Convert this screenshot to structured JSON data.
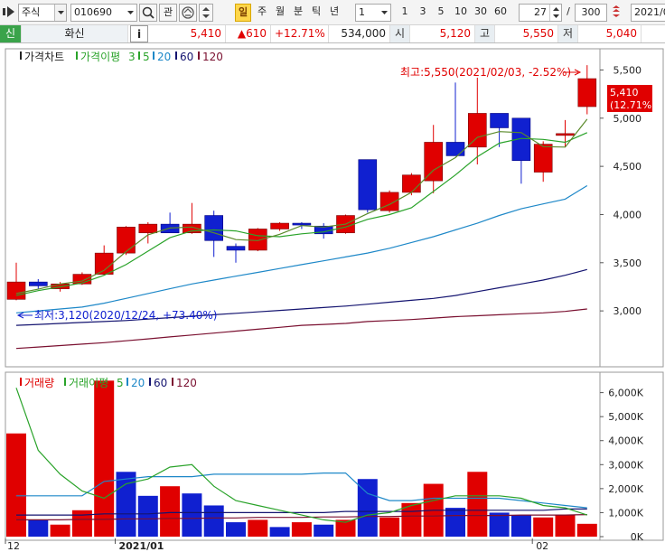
{
  "toolbar": {
    "market_select": "주식",
    "code_input": "010690",
    "watch_label": "관",
    "period_badge": "일",
    "period_tabs": [
      "주",
      "월",
      "분",
      "틱",
      "년"
    ],
    "unit_select": "1",
    "interval_buttons": [
      "1",
      "3",
      "5",
      "10",
      "30",
      "60"
    ],
    "count_value": "27",
    "slash": "/",
    "total_value": "300",
    "date_value": "2021/0"
  },
  "quote": {
    "credit_badge": "신",
    "name": "화신",
    "info_button": "i",
    "price": "5,410",
    "change": "▲610",
    "change_rate": "+12.71%",
    "volume": "534,000",
    "open_label": "시",
    "open": "5,120",
    "high_label": "고",
    "high": "5,550",
    "low_label": "저",
    "low": "5,040"
  },
  "colors": {
    "up": "#e00000",
    "down": "#1020d0",
    "ma5": "#2aa32a",
    "ma20": "#1e88c8",
    "ma60": "#141470",
    "ma120": "#7a1030"
  },
  "chart_data": [
    {
      "type": "candlestick",
      "legend": {
        "title": "가격차트",
        "ma_label": "가격이평",
        "items": [
          "3",
          "5",
          "20",
          "60",
          "120"
        ]
      },
      "x_labels": [
        {
          "label": "12",
          "index": 0
        },
        {
          "label": "2021/01",
          "index": 5
        },
        {
          "label": "02",
          "index": 24
        }
      ],
      "ylim": [
        2420,
        5720
      ],
      "yticks": [
        3000,
        3500,
        4000,
        4500,
        5000,
        5500
      ],
      "ytick_labels": [
        "3,000",
        "3,500",
        "4,000",
        "4,500",
        "5,000",
        "5,500"
      ],
      "candles": [
        {
          "o": 3120,
          "h": 3500,
          "l": 3110,
          "c": 3300
        },
        {
          "o": 3300,
          "h": 3330,
          "l": 3230,
          "c": 3260
        },
        {
          "o": 3230,
          "h": 3300,
          "l": 3200,
          "c": 3280
        },
        {
          "o": 3280,
          "h": 3400,
          "l": 3270,
          "c": 3380
        },
        {
          "o": 3380,
          "h": 3680,
          "l": 3370,
          "c": 3600
        },
        {
          "o": 3600,
          "h": 3880,
          "l": 3580,
          "c": 3870
        },
        {
          "o": 3810,
          "h": 3920,
          "l": 3700,
          "c": 3900
        },
        {
          "o": 3900,
          "h": 4020,
          "l": 3830,
          "c": 3810
        },
        {
          "o": 3810,
          "h": 4120,
          "l": 3800,
          "c": 3900
        },
        {
          "o": 3990,
          "h": 4040,
          "l": 3560,
          "c": 3730
        },
        {
          "o": 3670,
          "h": 3700,
          "l": 3500,
          "c": 3630
        },
        {
          "o": 3630,
          "h": 3860,
          "l": 3620,
          "c": 3850
        },
        {
          "o": 3850,
          "h": 3920,
          "l": 3830,
          "c": 3910
        },
        {
          "o": 3910,
          "h": 3920,
          "l": 3850,
          "c": 3900
        },
        {
          "o": 3880,
          "h": 3910,
          "l": 3750,
          "c": 3800
        },
        {
          "o": 3810,
          "h": 4000,
          "l": 3800,
          "c": 3990
        },
        {
          "o": 4570,
          "h": 4570,
          "l": 4020,
          "c": 4050
        },
        {
          "o": 4040,
          "h": 4250,
          "l": 4020,
          "c": 4230
        },
        {
          "o": 4230,
          "h": 4430,
          "l": 4200,
          "c": 4410
        },
        {
          "o": 4350,
          "h": 4930,
          "l": 4220,
          "c": 4750
        },
        {
          "o": 4750,
          "h": 5370,
          "l": 4630,
          "c": 4610
        },
        {
          "o": 4700,
          "h": 5420,
          "l": 4520,
          "c": 5050
        },
        {
          "o": 5050,
          "h": 5020,
          "l": 4700,
          "c": 4900
        },
        {
          "o": 5000,
          "h": 5000,
          "l": 4320,
          "c": 4560
        },
        {
          "o": 4440,
          "h": 4760,
          "l": 4340,
          "c": 4730
        },
        {
          "o": 4840,
          "h": 4980,
          "l": 4700,
          "c": 4840
        },
        {
          "o": 5120,
          "h": 5550,
          "l": 5040,
          "c": 5410
        }
      ],
      "ma3": [
        3180,
        3225,
        3280,
        3310,
        3420,
        3615,
        3790,
        3860,
        3870,
        3810,
        3740,
        3730,
        3795,
        3885,
        3870,
        3900,
        4010,
        4105,
        4230,
        4460,
        4590,
        4800,
        4860,
        4850,
        4705,
        4700,
        4990
      ],
      "ma5": [
        3160,
        3210,
        3250,
        3290,
        3370,
        3480,
        3620,
        3760,
        3830,
        3840,
        3830,
        3780,
        3770,
        3800,
        3820,
        3870,
        3950,
        4000,
        4070,
        4240,
        4410,
        4600,
        4740,
        4790,
        4780,
        4750,
        4850
      ],
      "ma20": [
        2980,
        3000,
        3020,
        3040,
        3080,
        3130,
        3180,
        3230,
        3280,
        3320,
        3360,
        3400,
        3440,
        3480,
        3520,
        3560,
        3600,
        3650,
        3710,
        3770,
        3840,
        3910,
        3990,
        4060,
        4110,
        4160,
        4300
      ],
      "ma60": [
        2850,
        2860,
        2870,
        2880,
        2890,
        2900,
        2915,
        2930,
        2945,
        2960,
        2975,
        2990,
        3005,
        3020,
        3035,
        3050,
        3070,
        3090,
        3110,
        3130,
        3160,
        3200,
        3240,
        3280,
        3320,
        3370,
        3430
      ],
      "ma120": [
        2610,
        2625,
        2640,
        2655,
        2670,
        2690,
        2710,
        2730,
        2750,
        2770,
        2790,
        2810,
        2830,
        2850,
        2860,
        2870,
        2890,
        2900,
        2910,
        2925,
        2940,
        2950,
        2960,
        2970,
        2980,
        2995,
        3020
      ],
      "annotations": {
        "high": "최고:5,550(2021/02/03, -2.52%)",
        "low": "최저:3,120(2020/12/24, +73.40%)",
        "current_price": "5,410",
        "current_rate": "(12.71%)"
      }
    },
    {
      "type": "bar",
      "legend": {
        "title": "거래량",
        "ma_label": "거래이평",
        "items": [
          "5",
          "20",
          "60",
          "120"
        ]
      },
      "ylim": [
        0,
        6700
      ],
      "yticks": [
        0,
        1000,
        2000,
        3000,
        4000,
        5000,
        6000
      ],
      "ytick_labels": [
        "0K",
        "1,000K",
        "2,000K",
        "3,000K",
        "4,000K",
        "5,000K",
        "6,000K"
      ],
      "volumes": [
        4300,
        700,
        500,
        1100,
        6500,
        2700,
        1700,
        2100,
        1800,
        1300,
        600,
        700,
        400,
        600,
        500,
        700,
        2400,
        800,
        1400,
        2200,
        1200,
        2700,
        1000,
        900,
        800,
        900,
        534
      ],
      "up": [
        true,
        false,
        true,
        true,
        true,
        false,
        false,
        true,
        false,
        false,
        false,
        true,
        false,
        true,
        false,
        true,
        false,
        true,
        true,
        true,
        false,
        true,
        false,
        false,
        true,
        true,
        true
      ],
      "vma5": [
        6200,
        3600,
        2600,
        1900,
        1600,
        2200,
        2400,
        2900,
        3000,
        2100,
        1500,
        1300,
        1100,
        900,
        700,
        600,
        900,
        1000,
        1300,
        1500,
        1700,
        1700,
        1700,
        1600,
        1300,
        1200,
        900
      ],
      "vma20": [
        1700,
        1700,
        1700,
        1700,
        2300,
        2400,
        2500,
        2500,
        2500,
        2600,
        2600,
        2600,
        2600,
        2600,
        2650,
        2650,
        1800,
        1500,
        1500,
        1600,
        1600,
        1600,
        1600,
        1500,
        1400,
        1300,
        1200
      ],
      "vma60": [
        900,
        900,
        900,
        900,
        950,
        950,
        950,
        1000,
        1000,
        1000,
        1000,
        1000,
        1000,
        1000,
        1000,
        1050,
        1050,
        1050,
        1050,
        1100,
        1100,
        1100,
        1100,
        1100,
        1100,
        1150,
        1150
      ],
      "vma120": [
        700,
        700,
        700,
        720,
        720,
        740,
        740,
        760,
        760,
        780,
        780,
        800,
        800,
        800,
        820,
        820,
        840,
        840,
        860,
        860,
        880,
        880,
        880,
        900,
        900,
        900,
        920
      ]
    }
  ]
}
